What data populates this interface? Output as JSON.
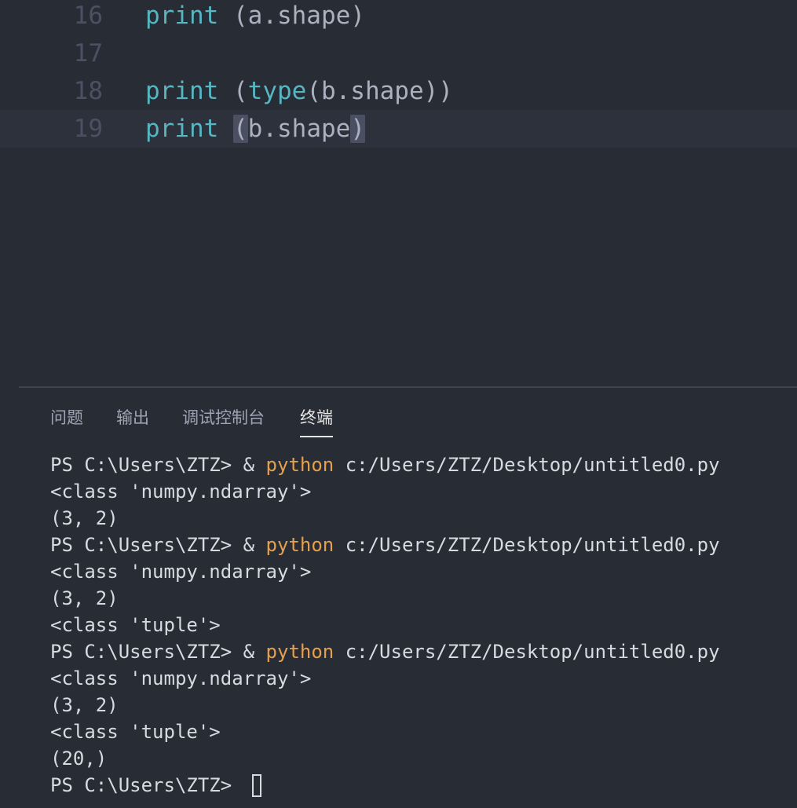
{
  "editor": {
    "lines": [
      {
        "number": "16",
        "fn": "print",
        "rest": " (a.shape)"
      },
      {
        "number": "17"
      },
      {
        "number": "18",
        "fn": "print",
        "open": " (",
        "inner_fn": "type",
        "rest": "(b.shape))"
      },
      {
        "number": "19",
        "fn": "print",
        "space": " ",
        "open_paren": "(",
        "arg": "b.shape",
        "close_paren": ")"
      }
    ]
  },
  "panel": {
    "tabs": [
      {
        "label": "问题"
      },
      {
        "label": "输出"
      },
      {
        "label": "调试控制台"
      },
      {
        "label": "终端",
        "active": true
      }
    ]
  },
  "terminal": {
    "prompt": "PS C:\\Users\\ZTZ> ",
    "amp": "& ",
    "cmd": "python",
    "script": " c:/Users/ZTZ/Desktop/untitled0.py",
    "output": {
      "o1": "<class 'numpy.ndarray'>",
      "o2": "(3, 2)",
      "o3": "<class 'numpy.ndarray'>",
      "o4": "(3, 2)",
      "o5": "<class 'tuple'>",
      "o6": "<class 'numpy.ndarray'>",
      "o7": "(3, 2)",
      "o8": "<class 'tuple'>",
      "o9": "(20,)"
    },
    "final_prompt": "PS C:\\Users\\ZTZ> "
  },
  "colors": {
    "background": "#282c34",
    "function": "#56b6c2",
    "command": "#e5a04d",
    "line_number": "#495162",
    "text": "#abb2bf"
  }
}
